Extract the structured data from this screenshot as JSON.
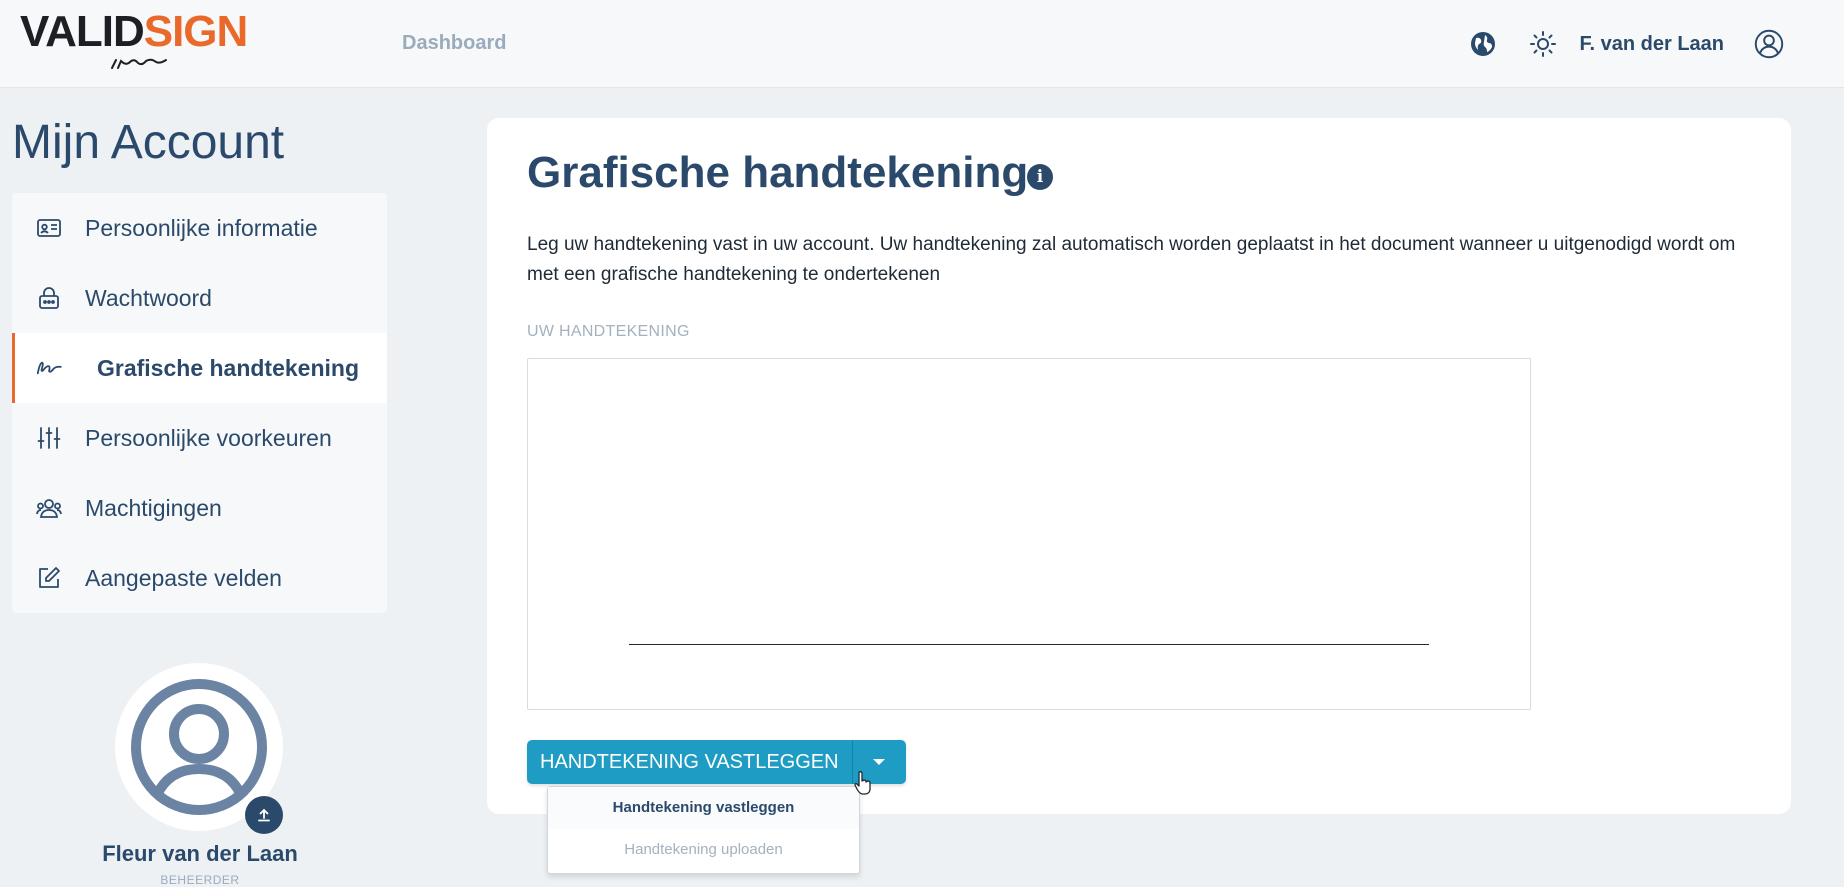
{
  "header": {
    "logo_valid": "VALID",
    "logo_sign": "SIGN",
    "nav_dashboard": "Dashboard",
    "user_name": "F. van der Laan",
    "icons": [
      "globe-icon",
      "sun-icon",
      "user-circle-icon"
    ]
  },
  "sidebar": {
    "title": "Mijn Account",
    "items": [
      {
        "label": "Persoonlijke informatie",
        "icon": "id-card-icon",
        "active": false
      },
      {
        "label": "Wachtwoord",
        "icon": "lock-icon",
        "active": false
      },
      {
        "label": "Grafische handtekening",
        "icon": "signature-icon",
        "active": true
      },
      {
        "label": "Persoonlijke voorkeuren",
        "icon": "sliders-icon",
        "active": false
      },
      {
        "label": "Machtigingen",
        "icon": "users-icon",
        "active": false
      },
      {
        "label": "Aangepaste velden",
        "icon": "edit-icon",
        "active": false
      }
    ],
    "active_accent": "#e8692a"
  },
  "profile": {
    "name": "Fleur van der Laan",
    "role": "BEHEERDER"
  },
  "main": {
    "title": "Grafische handtekening",
    "description": "Leg uw handtekening vast in uw account. Uw handtekening zal automatisch worden geplaatst in het document wanneer u uitgenodigd wordt om met een grafische handtekening te ondertekenen",
    "signature_label": "UW HANDTEKENING",
    "save_button": "HANDTEKENING VASTLEGGEN",
    "dropdown": {
      "items": [
        "Handtekening vastleggen",
        "Handtekening uploaden"
      ]
    }
  },
  "colors": {
    "primary_text": "#2b4a6b",
    "button": "#1e9cc4",
    "brand_orange": "#e8692a"
  }
}
